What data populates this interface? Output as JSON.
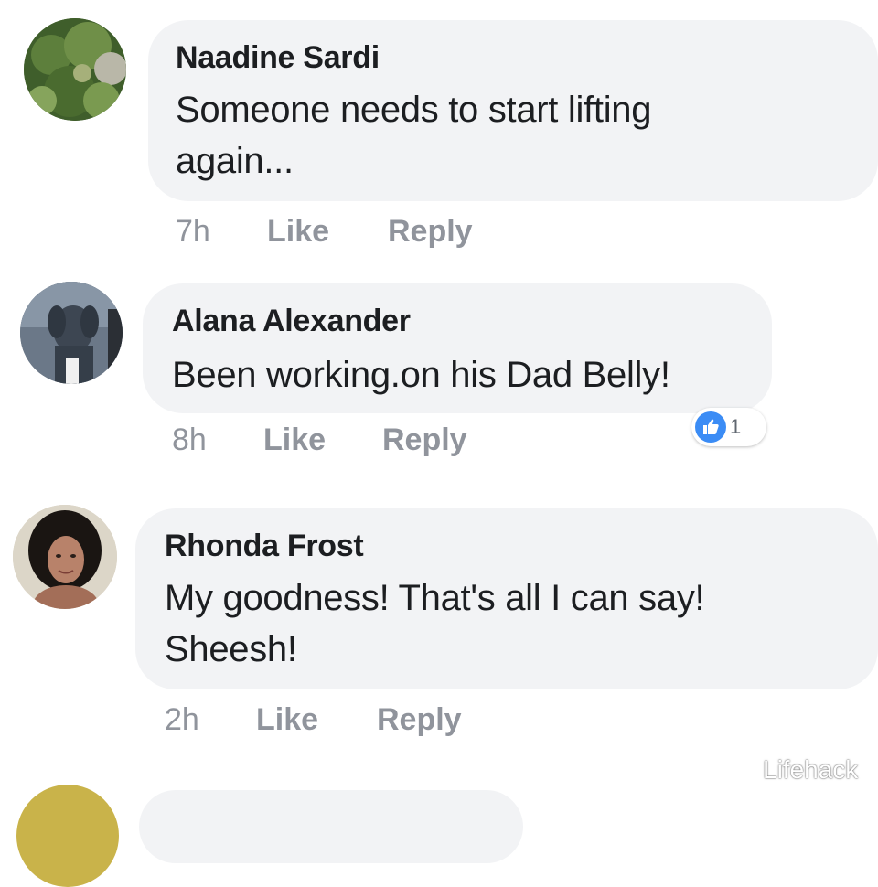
{
  "comments": [
    {
      "author": "Naadine Sardi",
      "text": "Someone needs to start lifting again...",
      "time": "7h",
      "like_label": "Like",
      "reply_label": "Reply",
      "avatar_icon": "landscape-avatar"
    },
    {
      "author": "Alana Alexander",
      "text": "Been working.on his Dad Belly!",
      "time": "8h",
      "like_label": "Like",
      "reply_label": "Reply",
      "avatar_icon": "dog-avatar",
      "reaction": {
        "icon": "thumbs-up-icon",
        "count": "1",
        "color": "#3b8cf5"
      }
    },
    {
      "author": "Rhonda Frost",
      "text": "My goodness! That's all I can say! Sheesh!",
      "time": "2h",
      "like_label": "Like",
      "reply_label": "Reply",
      "avatar_icon": "person-avatar"
    }
  ],
  "watermark": {
    "icon": "wechat-icon",
    "text": "Lifehack"
  },
  "colors": {
    "bubble": "#f2f3f5",
    "action_text": "#90949c",
    "body_text": "#1c1e21"
  }
}
